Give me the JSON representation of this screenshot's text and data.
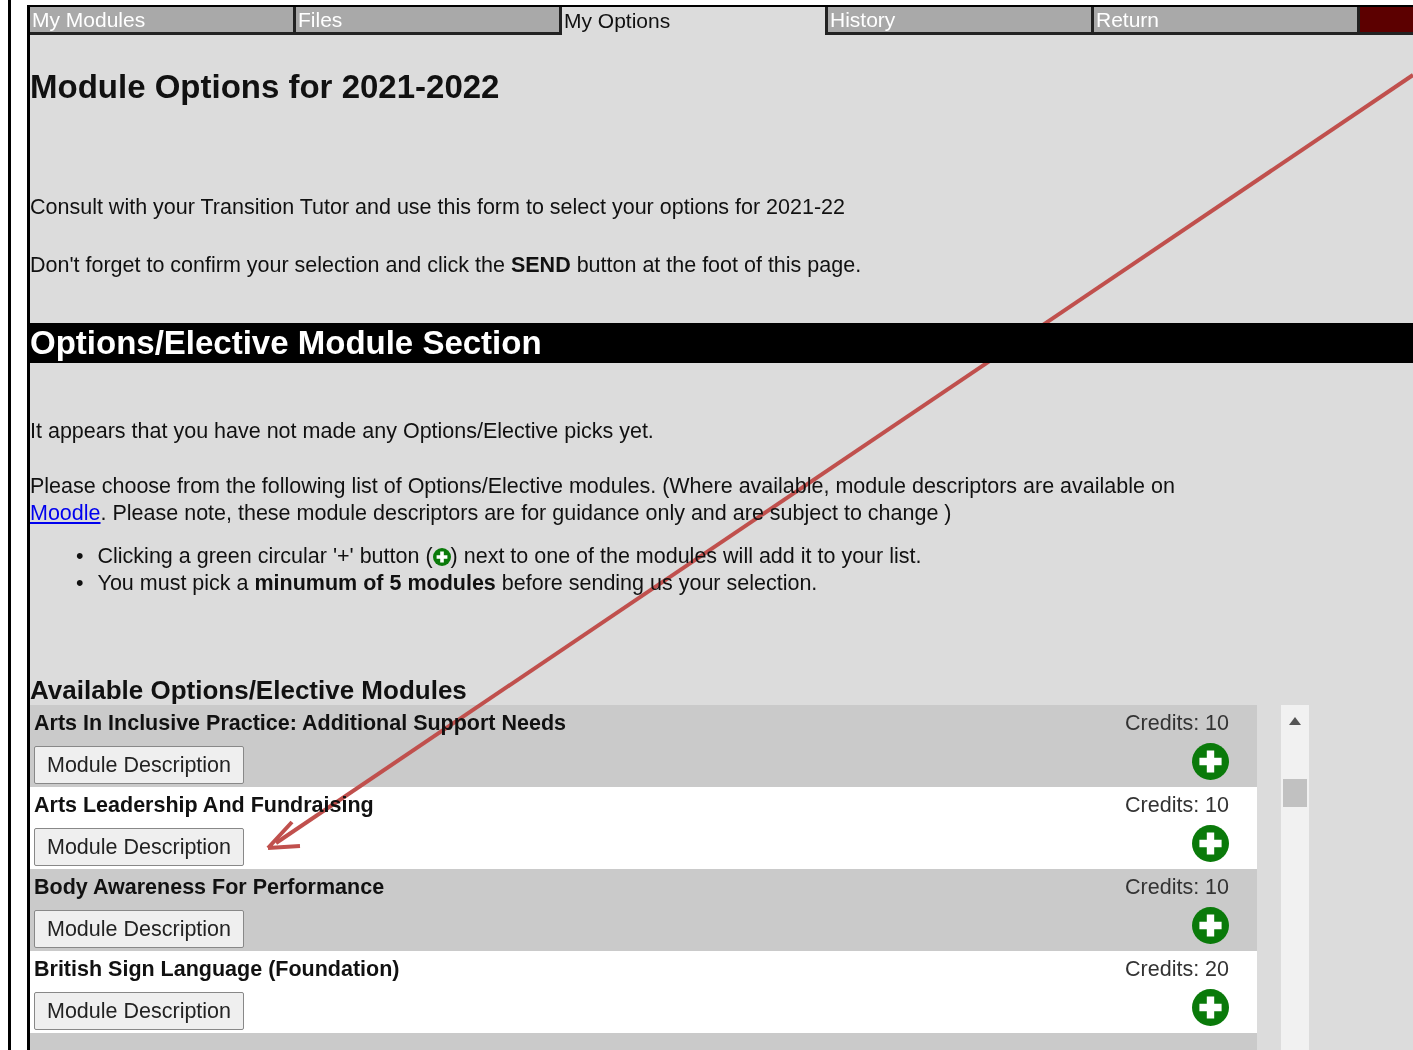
{
  "tabs": [
    {
      "label": "My Modules",
      "selected": false
    },
    {
      "label": "Files",
      "selected": false
    },
    {
      "label": "My Options",
      "selected": true
    },
    {
      "label": "History",
      "selected": false
    },
    {
      "label": "Return",
      "selected": false
    }
  ],
  "heading": "Module Options for 2021-2022",
  "intro": [
    "Consult with your Transition Tutor and use this form to select your options for 2021-22",
    "Don't forget to confirm your selection and click the **SEND** button at the foot of this page."
  ],
  "section_title": "Options/Elective Module Section",
  "notice": "It appears that you have not made any Options/Elective picks yet.",
  "choose": {
    "before": "Please choose from the following list of Options/Elective modules. (Where available, module descriptors are available on ",
    "link": "Moodle",
    "after": ". Please note, these module descriptors are for guidance only and are subject to change )"
  },
  "bullets": [
    {
      "kind": "icon-text",
      "marker": "•",
      "before": "Clicking a green circular '+' button (",
      "after": ") next to one of the modules will add it to your list."
    },
    {
      "kind": "text",
      "marker": "•",
      "text": "You must pick a **minumum of 5 modules** before sending us your selection."
    }
  ],
  "list_title": "Available Options/Elective Modules",
  "modules": [
    {
      "title": "Arts In Inclusive Practice: Additional Support Needs",
      "credits": "Credits: 10",
      "button": "Module Description"
    },
    {
      "title": "Arts Leadership And Fundraising",
      "credits": "Credits: 10",
      "button": "Module Description"
    },
    {
      "title": "Body Awareness For Performance",
      "credits": "Credits: 10",
      "button": "Module Description"
    },
    {
      "title": "British Sign Language (Foundation)",
      "credits": "Credits: 20",
      "button": "Module Description"
    }
  ]
}
